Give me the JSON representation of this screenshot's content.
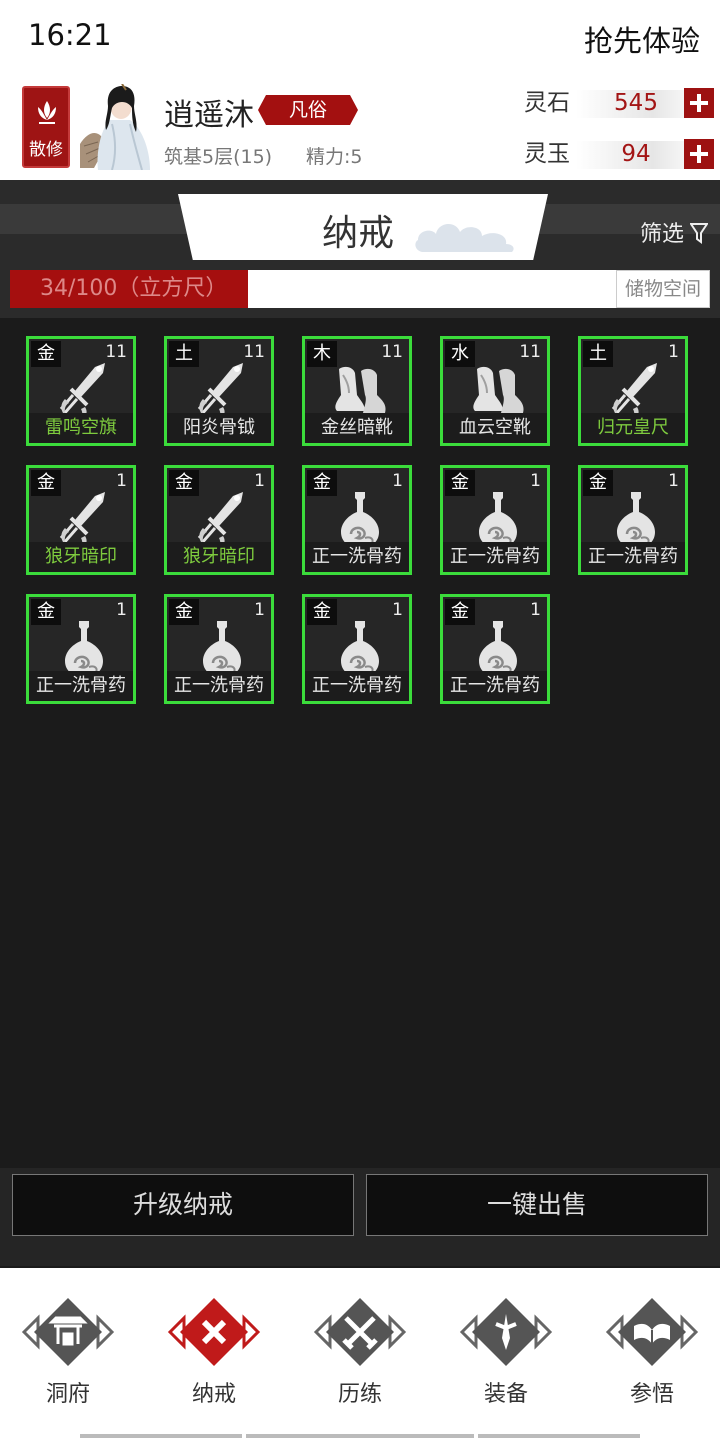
{
  "status_bar": {
    "time": "16:21",
    "action": "抢先体验"
  },
  "profile": {
    "sect": "散修",
    "name": "逍遥沐",
    "rank": "凡俗",
    "realm": "筑基5层(15)",
    "energy": "精力:5",
    "currencies": [
      {
        "label": "灵石",
        "value": "545"
      },
      {
        "label": "灵玉",
        "value": "94"
      }
    ]
  },
  "title": {
    "text": "纳戒",
    "filter_label": "筛选"
  },
  "capacity": {
    "text": "34/100（立方尺）",
    "used": 34,
    "total": 100,
    "storage_button": "储物空间"
  },
  "items": [
    {
      "element": "金",
      "qty": "11",
      "name": "雷鸣空旗",
      "icon": "dagger-icon",
      "green": true
    },
    {
      "element": "土",
      "qty": "11",
      "name": "阳炎骨钺",
      "icon": "dagger-icon",
      "green": false
    },
    {
      "element": "木",
      "qty": "11",
      "name": "金丝暗靴",
      "icon": "boots-icon",
      "green": false
    },
    {
      "element": "水",
      "qty": "11",
      "name": "血云空靴",
      "icon": "boots-icon",
      "green": false
    },
    {
      "element": "土",
      "qty": "1",
      "name": "归元皇尺",
      "icon": "dagger-icon",
      "green": true
    },
    {
      "element": "金",
      "qty": "1",
      "name": "狼牙暗印",
      "icon": "dagger-icon",
      "green": true
    },
    {
      "element": "金",
      "qty": "1",
      "name": "狼牙暗印",
      "icon": "dagger-icon",
      "green": true
    },
    {
      "element": "金",
      "qty": "1",
      "name": "正一洗骨药",
      "icon": "potion-icon",
      "green": false
    },
    {
      "element": "金",
      "qty": "1",
      "name": "正一洗骨药",
      "icon": "potion-icon",
      "green": false
    },
    {
      "element": "金",
      "qty": "1",
      "name": "正一洗骨药",
      "icon": "potion-icon",
      "green": false
    },
    {
      "element": "金",
      "qty": "1",
      "name": "正一洗骨药",
      "icon": "potion-icon",
      "green": false
    },
    {
      "element": "金",
      "qty": "1",
      "name": "正一洗骨药",
      "icon": "potion-icon",
      "green": false
    },
    {
      "element": "金",
      "qty": "1",
      "name": "正一洗骨药",
      "icon": "potion-icon",
      "green": false
    },
    {
      "element": "金",
      "qty": "1",
      "name": "正一洗骨药",
      "icon": "potion-icon",
      "green": false
    }
  ],
  "actions": {
    "upgrade": "升级纳戒",
    "sell_all": "一键出售"
  },
  "tabs": [
    {
      "label": "洞府",
      "icon": "gate-icon",
      "active": false
    },
    {
      "label": "纳戒",
      "icon": "cross-icon",
      "active": true
    },
    {
      "label": "历练",
      "icon": "crossed-swords-icon",
      "active": false
    },
    {
      "label": "装备",
      "icon": "sword-icon",
      "active": false
    },
    {
      "label": "参悟",
      "icon": "book-icon",
      "active": false
    }
  ],
  "colors": {
    "accent_red": "#a31010",
    "item_border_green": "#3bdc3b",
    "item_name_green": "#7ecb3e",
    "background": "#1b1b1b"
  }
}
